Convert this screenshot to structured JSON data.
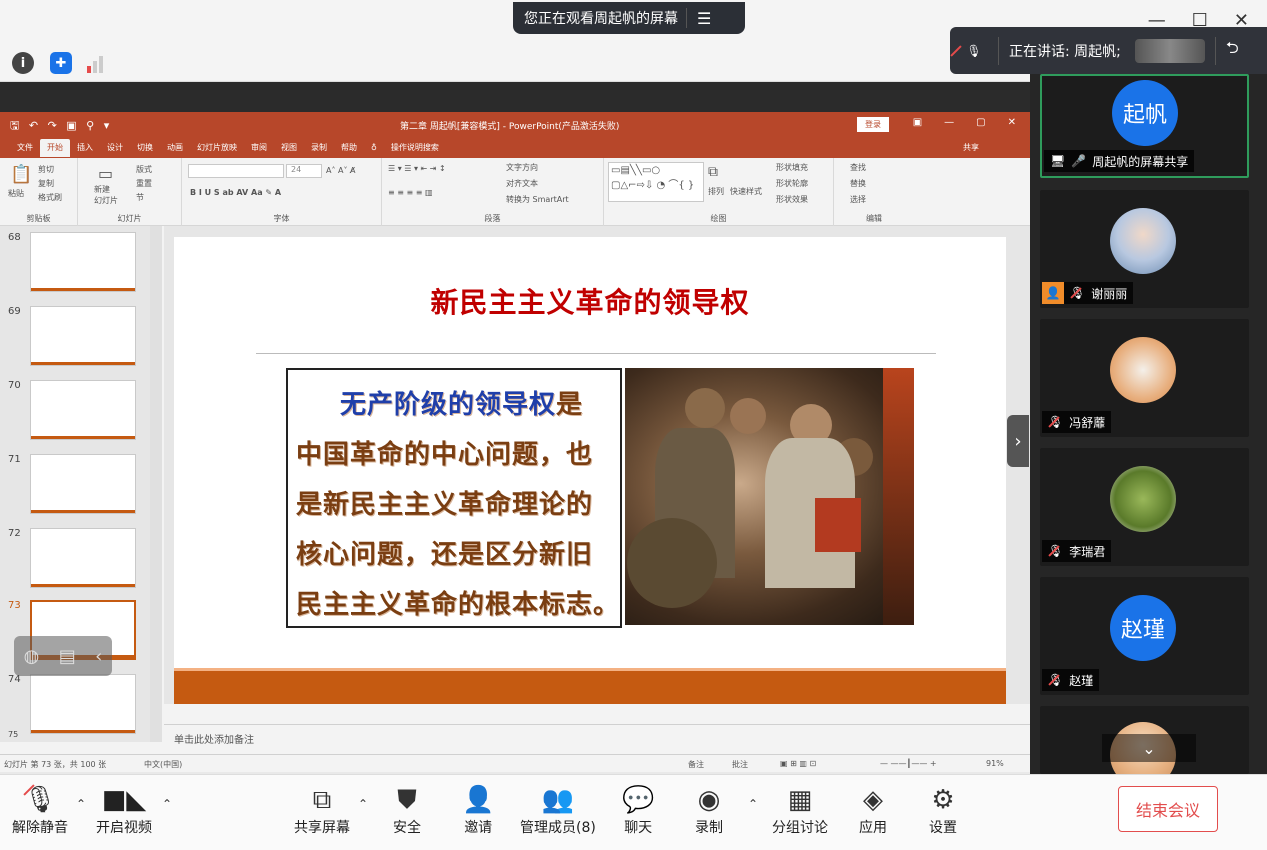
{
  "window": {
    "viewing_banner": "您正在观看周起帆的屏幕",
    "controls": [
      "—",
      "☐",
      "✕"
    ]
  },
  "speaking": {
    "label": "正在讲话: 周起帆;"
  },
  "ppt": {
    "title": "第二章 周起帆[兼容模式] - PowerPoint(产品激活失败)",
    "login": "登录",
    "tabs": [
      "文件",
      "开始",
      "插入",
      "设计",
      "切换",
      "动画",
      "幻灯片放映",
      "审阅",
      "视图",
      "录制",
      "帮助"
    ],
    "search": "操作说明搜索",
    "share": "共享",
    "groups": {
      "clipboard": "剪贴板",
      "slides": "幻灯片",
      "font": "字体",
      "paragraph": "段落",
      "drawing": "绘图",
      "editing": "编辑"
    },
    "ribbon": {
      "paste": "粘贴",
      "cut": "剪切",
      "copy": "复制",
      "format_painter": "格式刷",
      "new_slide": "新建\n幻灯片",
      "layout": "版式",
      "reset": "重置",
      "section": "节",
      "font_size": "24",
      "text_direction": "文字方向",
      "align_text": "对齐文本",
      "smartart": "转换为 SmartArt",
      "arrange": "排列",
      "quick_styles": "快速样式",
      "shape_fill": "形状填充",
      "shape_outline": "形状轮廓",
      "shape_effects": "形状效果",
      "find": "查找",
      "replace": "替换",
      "select": "选择"
    },
    "thumbs": [
      {
        "num": "68"
      },
      {
        "num": "69"
      },
      {
        "num": "70"
      },
      {
        "num": "71"
      },
      {
        "num": "72"
      },
      {
        "num": "73"
      },
      {
        "num": "74"
      },
      {
        "num": "75"
      }
    ],
    "slide": {
      "title": "新民主主义革命的领导权",
      "lines": [
        {
          "hl": "无产阶级的领导权",
          "rest": "是"
        },
        {
          "hl": "",
          "rest": "中国革命的中心问题，也"
        },
        {
          "hl": "",
          "rest": "是新民主主义革命理论的"
        },
        {
          "hl": "",
          "rest": "核心问题，还是区分新旧"
        },
        {
          "hl": "",
          "rest": "民主主义革命的根本标志。"
        }
      ]
    },
    "notes": "单击此处添加备注",
    "status": {
      "slide_count": "幻灯片 第 73 张，共 100 张",
      "language": "中文(中国)",
      "notes_btn": "备注",
      "comments_btn": "批注",
      "zoom": "91%"
    }
  },
  "participants": [
    {
      "name": "周起帆的屏幕共享",
      "avatar_text": "起帆",
      "color": "#1a73e8",
      "speaking": true
    },
    {
      "name": "谢丽丽",
      "avatar_text": "",
      "color": "#8aa7c9",
      "host": true
    },
    {
      "name": "冯舒蘼",
      "avatar_text": "",
      "color": "#e0a46a"
    },
    {
      "name": "李瑞君",
      "avatar_text": "",
      "color": "#6c8f3a"
    },
    {
      "name": "赵瑾",
      "avatar_text": "赵瑾",
      "color": "#1a73e8"
    },
    {
      "name": "",
      "avatar_text": "",
      "color": "#e8c49d"
    }
  ],
  "bottom": {
    "unmute": "解除静音",
    "video": "开启视频",
    "share": "共享屏幕",
    "security": "安全",
    "invite": "邀请",
    "manage": "管理成员(8)",
    "chat": "聊天",
    "record": "录制",
    "breakout": "分组讨论",
    "apps": "应用",
    "settings": "设置",
    "end": "结束会议"
  }
}
